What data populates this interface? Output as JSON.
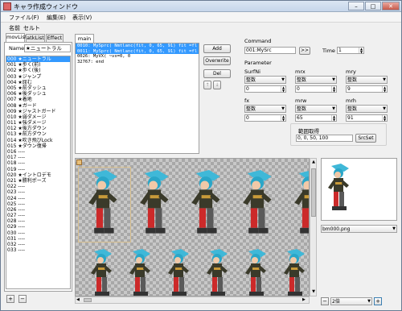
{
  "window": {
    "title": "キャラ作成ウィンドウ",
    "minimize": "–",
    "maximize": "□",
    "close": "✕"
  },
  "menu": {
    "file": "ファイル(F)",
    "edit": "編集(E)",
    "view": "表示(V)"
  },
  "menu2": {
    "name": "名前",
    "set": "セルト"
  },
  "left_tabs": [
    "movList",
    "atkList",
    "Effect"
  ],
  "name_label": "Name",
  "name_value": "★ニュートラル",
  "motion_list": [
    "000 ★ニュートラル",
    "001 ★歩く(前)",
    "002 ★歩く(後)",
    "003 ★ジャンプ",
    "004 ★屈む",
    "005 ★前ダッシュ",
    "006 ★後ダッシュ",
    "007 ★着地",
    "008 ★ガード",
    "009 ★ジャストガード",
    "010 ★弱ダメージ",
    "011 ★強ダメージ",
    "012 ★後方ダウン",
    "013 ★前方ダウン",
    "014 ★吹き飛びLock",
    "015 ★ダウン復帰",
    "016 ----",
    "017 ----",
    "018 ----",
    "019 ----",
    "020 ★イントロデモ",
    "021 ★勝利ポーズ",
    "022 ----",
    "023 ----",
    "024 ----",
    "025 ----",
    "026 ----",
    "027 ----",
    "028 ----",
    "029 ----",
    "030 ----",
    "031 ----",
    "032 ----",
    "033 ----"
  ],
  "main_tab": "main",
  "commands": [
    "0010: MySprc( Nmtlanc(fit, 0, 65, 91) fit =fl",
    "0011: MySprc( Nmtlanc(fit, 0, 65, 91) fit =fl",
    "0026: MyVX( ~vx=0, 0",
    "32767: end"
  ],
  "buttons": {
    "add": "Add",
    "overwrite": "Overwrite",
    "del": "Del",
    "up": "↑",
    "down": "↓",
    "plus": "+",
    "minus": "−",
    "srcset": "SrcSet",
    "go": ">>"
  },
  "command": {
    "label": "Command",
    "value": "001:MySrc",
    "time_label": "Time",
    "time_value": "1"
  },
  "parameter": {
    "label": "Parameter",
    "fields": [
      {
        "label": "SurfNi",
        "select": "整数",
        "value": "0"
      },
      {
        "label": "mrx",
        "select": "整数",
        "value": "0"
      },
      {
        "label": "mry",
        "select": "整数",
        "value": "9"
      },
      {
        "label": "fx",
        "select": "整数",
        "value": "0"
      },
      {
        "label": "mrw",
        "select": "整数",
        "value": "65"
      },
      {
        "label": "mrh",
        "select": "整数",
        "value": "91"
      }
    ]
  },
  "source": {
    "label": "範囲取得",
    "value": "0, 0, 50, 100"
  },
  "image_select": "bm000.png",
  "zoom": "2倍"
}
